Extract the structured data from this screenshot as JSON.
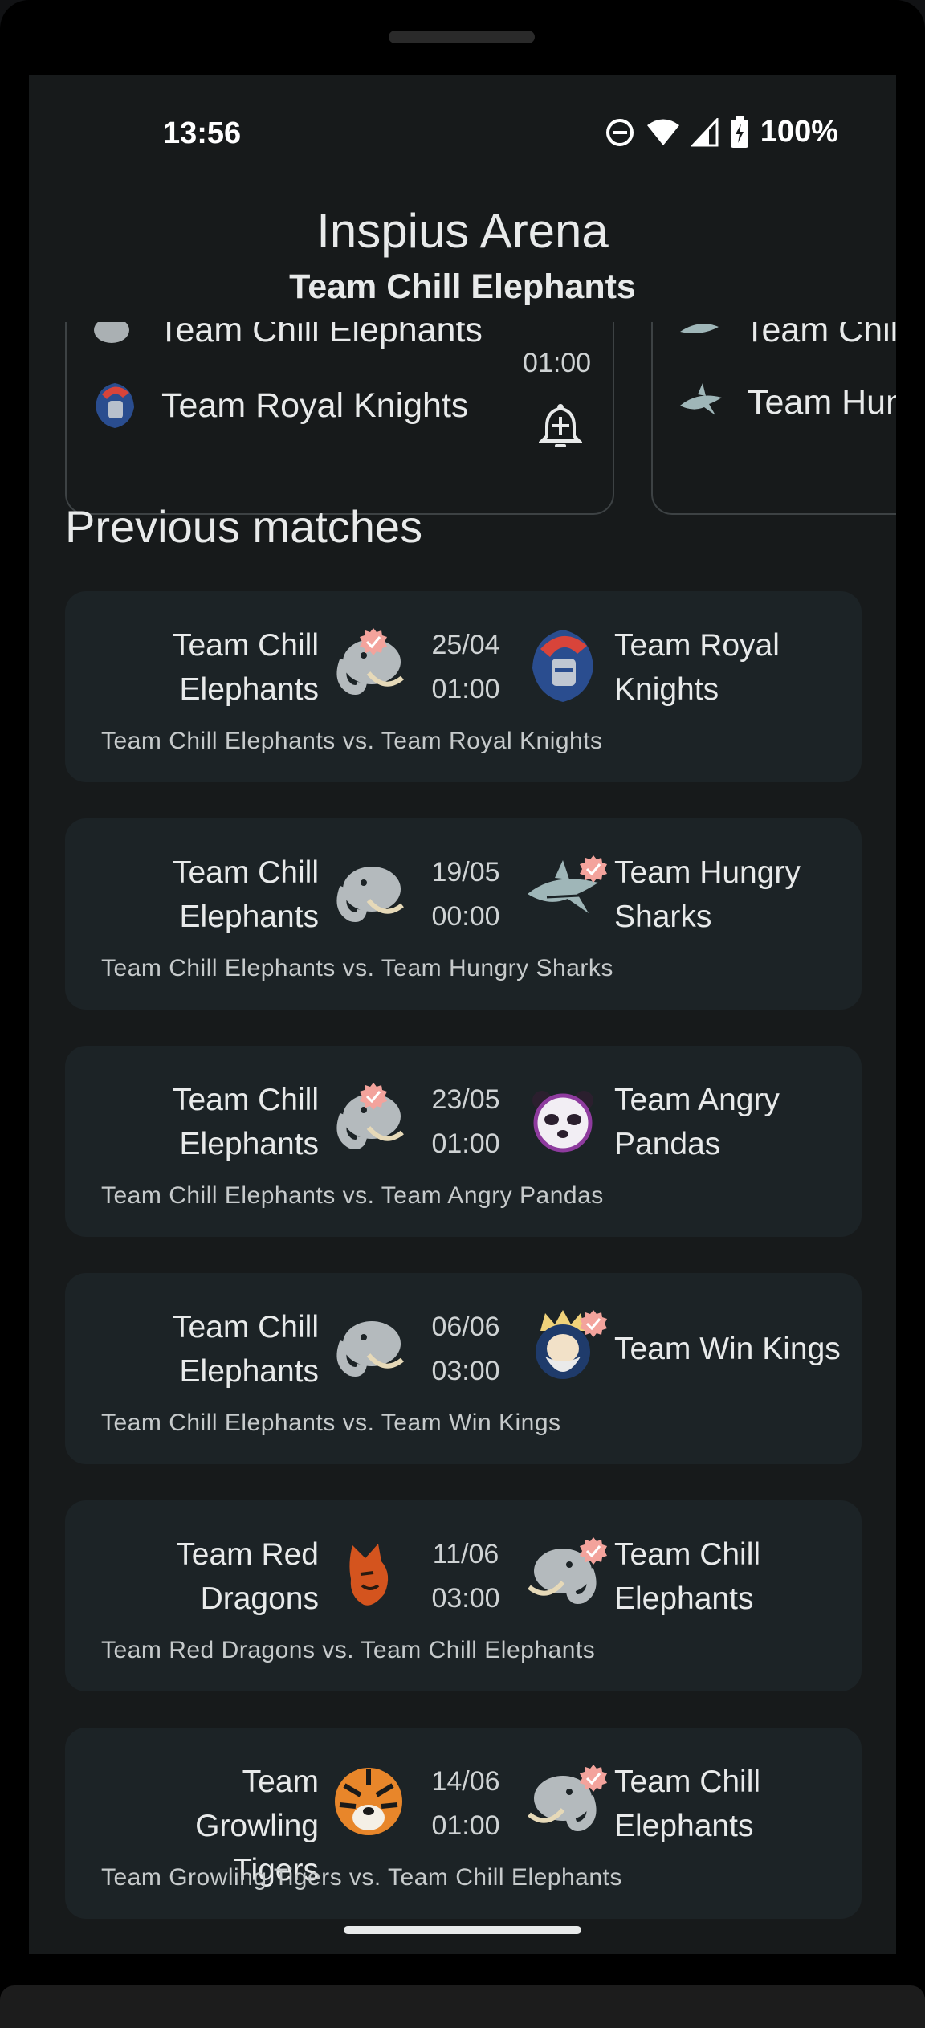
{
  "status_bar": {
    "time": "13:56",
    "battery": "100%"
  },
  "header": {
    "title": "Inspius Arena",
    "subtitle": "Team Chill Elephants"
  },
  "upcoming": [
    {
      "home": "Team Chill Elephants",
      "away": "Team Royal Knights",
      "time": "01:00"
    },
    {
      "home": "Team Chill Elephants",
      "away": "Team Hungry Sharks"
    }
  ],
  "previous_section_title": "Previous matches",
  "matches": [
    {
      "home_l1": "Team Chill",
      "home_l2": "Elephants",
      "date": "25/04",
      "time": "01:00",
      "away_l1": "Team Royal",
      "away_l2": "Knights",
      "desc": "Team Chill Elephants vs. Team Royal Knights",
      "home_logo": "elephant-logo",
      "away_logo": "knight-logo",
      "winner": "home"
    },
    {
      "home_l1": "Team Chill",
      "home_l2": "Elephants",
      "date": "19/05",
      "time": "00:00",
      "away_l1": "Team Hungry",
      "away_l2": "Sharks",
      "desc": "Team Chill Elephants vs. Team Hungry Sharks",
      "home_logo": "elephant-logo",
      "away_logo": "shark-logo",
      "winner": "away"
    },
    {
      "home_l1": "Team Chill",
      "home_l2": "Elephants",
      "date": "23/05",
      "time": "01:00",
      "away_l1": "Team Angry",
      "away_l2": "Pandas",
      "desc": "Team Chill Elephants vs. Team Angry Pandas",
      "home_logo": "elephant-logo",
      "away_logo": "panda-logo",
      "winner": "home"
    },
    {
      "home_l1": "Team Chill",
      "home_l2": "Elephants",
      "date": "06/06",
      "time": "03:00",
      "away_l1": "Team Win Kings",
      "away_l2": "",
      "desc": "Team Chill Elephants vs. Team Win Kings",
      "home_logo": "elephant-logo",
      "away_logo": "king-logo",
      "winner": "away"
    },
    {
      "home_l1": "Team Red",
      "home_l2": "Dragons",
      "date": "11/06",
      "time": "03:00",
      "away_l1": "Team Chill",
      "away_l2": "Elephants",
      "desc": "Team Red Dragons vs. Team Chill Elephants",
      "home_logo": "dragon-logo",
      "away_logo": "elephant-logo",
      "winner": "away"
    },
    {
      "home_l1": "Team Growling",
      "home_l2": "Tigers",
      "date": "14/06",
      "time": "01:00",
      "away_l1": "Team Chill",
      "away_l2": "Elephants",
      "desc": "Team Growling Tigers vs. Team Chill Elephants",
      "home_logo": "tiger-logo",
      "away_logo": "elephant-logo",
      "winner": "away"
    }
  ],
  "colors": {
    "background": "#171a1b",
    "card": "#1c2326",
    "winner_badge": "#f3a39c",
    "text": "#e8eaea"
  }
}
